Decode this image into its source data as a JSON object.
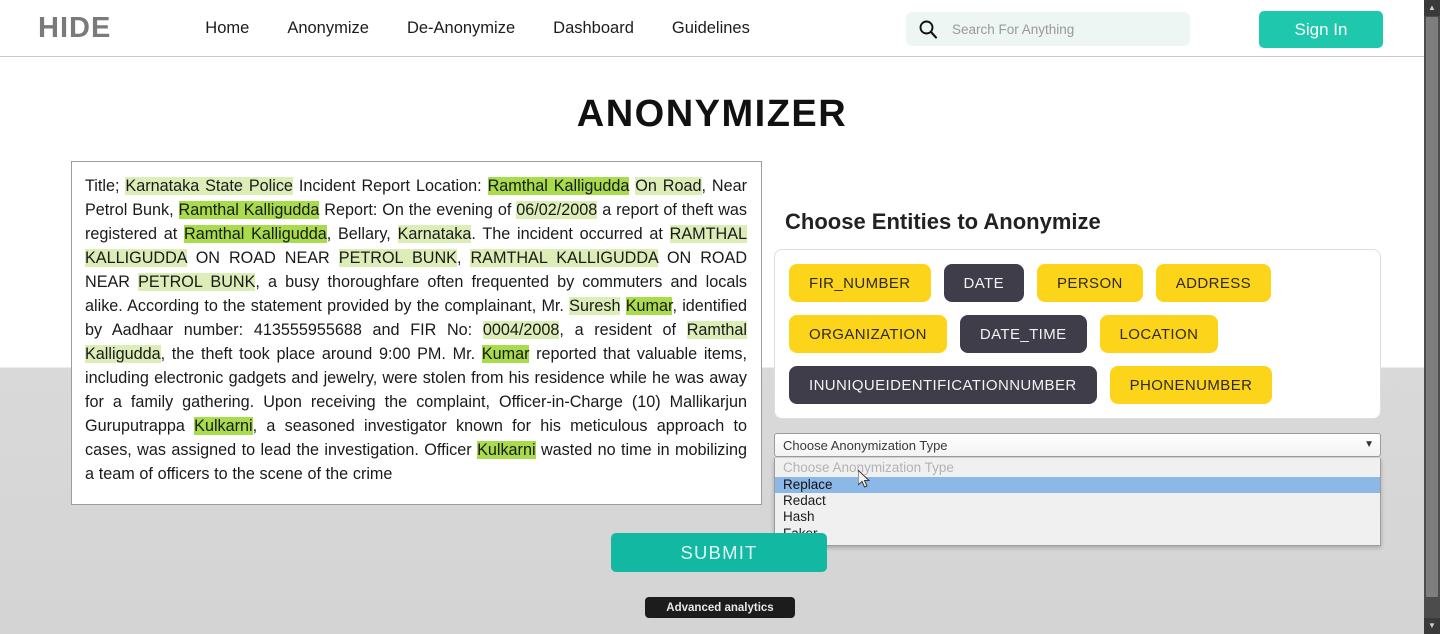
{
  "header": {
    "logo": "HIDE",
    "nav": [
      {
        "label": "Home",
        "name": "nav-home"
      },
      {
        "label": "Anonymize",
        "name": "nav-anonymize"
      },
      {
        "label": "De-Anonymize",
        "name": "nav-de-anonymize"
      },
      {
        "label": "Dashboard",
        "name": "nav-dashboard"
      },
      {
        "label": "Guidelines",
        "name": "nav-guidelines"
      }
    ],
    "search": {
      "value": "",
      "placeholder": "Search For Anything",
      "icon": "search-icon"
    },
    "sign_in_label": "Sign In",
    "accent_color": "#1fc8ac"
  },
  "page": {
    "title": "ANONYMIZER"
  },
  "report": {
    "full_text": "Title; Karnataka State Police Incident Report Location: Ramthal Kalligudda On Road, Near Petrol Bunk, Ramthal Kalligudda Report: On the evening of 06/02/2008 a report of theft was registered at Ramthal Kalligudda, Bellary, Karnataka. The incident occurred at RAMTHAL KALLIGUDDA ON ROAD NEAR PETROL BUNK, RAMTHAL KALLIGUDDA ON ROAD NEAR PETROL BUNK, a busy thoroughfare often frequented by commuters and locals alike. According to the statement provided by the complainant, Mr. Suresh Kumar, identified by Aadhaar number: 413555955688 and FIR No: 0004/2008, a resident of Ramthal Kalligudda, the theft took place around 9:00 PM. Mr. Kumar reported that valuable items, including electronic gadgets and jewelry, were stolen from his residence while he was away for a family gathering. Upon receiving the complaint, Officer-in-Charge (10) Mallikarjun Guruputrappa Kulkarni, a seasoned investigator known for his meticulous approach to cases, was assigned to lead the investigation. Officer Kulkarni wasted no time in mobilizing a team of officers to the scene of the crime",
    "segments": [
      {
        "t": "Title; ",
        "h": "none"
      },
      {
        "t": "Karnataka State Police",
        "h": "light"
      },
      {
        "t": " Incident Report Location: ",
        "h": "none"
      },
      {
        "t": "Ramthal Kalligudda",
        "h": "bright"
      },
      {
        "t": " ",
        "h": "none"
      },
      {
        "t": "On Road",
        "h": "light"
      },
      {
        "t": ", Near Petrol Bunk, ",
        "h": "none"
      },
      {
        "t": "Ramthal Kalligudda",
        "h": "bright"
      },
      {
        "t": " Report: On the evening of ",
        "h": "none"
      },
      {
        "t": "06/02/2008",
        "h": "light"
      },
      {
        "t": " a report of theft was registered at ",
        "h": "none"
      },
      {
        "t": "Ramthal Kalligudda",
        "h": "bright"
      },
      {
        "t": ", Bellary, ",
        "h": "none"
      },
      {
        "t": "Karnataka",
        "h": "light"
      },
      {
        "t": ". The incident occurred at ",
        "h": "none"
      },
      {
        "t": "RAMTHAL KALLIGUDDA",
        "h": "light"
      },
      {
        "t": " ON ROAD NEAR ",
        "h": "none"
      },
      {
        "t": "PETROL BUNK",
        "h": "light"
      },
      {
        "t": ", ",
        "h": "none"
      },
      {
        "t": "RAMTHAL KALLIGUDDA",
        "h": "light"
      },
      {
        "t": " ON ROAD NEAR ",
        "h": "none"
      },
      {
        "t": "PETROL BUNK",
        "h": "light"
      },
      {
        "t": ", a busy thoroughfare often frequented by commuters and locals alike. According to the statement provided by the complainant, Mr. ",
        "h": "none"
      },
      {
        "t": "Suresh",
        "h": "light"
      },
      {
        "t": " ",
        "h": "none"
      },
      {
        "t": "Kumar",
        "h": "bright"
      },
      {
        "t": ", identified by Aadhaar number: 413555955688 and FIR No: ",
        "h": "none"
      },
      {
        "t": "0004/2008",
        "h": "light"
      },
      {
        "t": ", a resident of ",
        "h": "none"
      },
      {
        "t": "Ramthal Kalligudda",
        "h": "light"
      },
      {
        "t": ", the theft took place around 9:00 PM. Mr. ",
        "h": "none"
      },
      {
        "t": "Kumar",
        "h": "bright"
      },
      {
        "t": " reported that valuable items, including electronic gadgets and jewelry, were stolen from his residence while he was away for a family gathering. Upon receiving the complaint, Officer-in-Charge (10) Mallikarjun Guruputrappa ",
        "h": "none"
      },
      {
        "t": "Kulkarni",
        "h": "bright"
      },
      {
        "t": ", a seasoned investigator known for his meticulous approach to cases, was assigned to lead the investigation. Officer ",
        "h": "none"
      },
      {
        "t": "Kulkarni",
        "h": "bright"
      },
      {
        "t": " wasted no time in mobilizing a team of officers to the scene of the crime",
        "h": "none"
      }
    ],
    "highlight_colors": {
      "light": "#dcedb8",
      "bright": "#a9dc4c"
    }
  },
  "entities": {
    "title": "Choose Entities to Anonymize",
    "selected_color": "#fcd419",
    "unselected_color": "#3f3d4a",
    "rows": [
      [
        {
          "label": "FIR_NUMBER",
          "state": "on"
        },
        {
          "label": "DATE",
          "state": "off"
        },
        {
          "label": "PERSON",
          "state": "on"
        },
        {
          "label": "ADDRESS",
          "state": "on"
        }
      ],
      [
        {
          "label": "ORGANIZATION",
          "state": "on"
        },
        {
          "label": "DATE_TIME",
          "state": "off"
        },
        {
          "label": "LOCATION",
          "state": "on"
        }
      ],
      [
        {
          "label": "INUNIQUEIDENTIFICATIONNUMBER",
          "state": "off"
        },
        {
          "label": "PHONENUMBER",
          "state": "on"
        }
      ]
    ]
  },
  "anonymization_select": {
    "selected_value": "Choose Anonymization Type",
    "expanded": true,
    "highlighted_option": "Replace",
    "chevron_icon": "chevron-down-icon",
    "options": [
      {
        "label": "Choose Anonymization Type",
        "placeholder": true,
        "selected": false
      },
      {
        "label": "Replace",
        "placeholder": false,
        "selected": true
      },
      {
        "label": "Redact",
        "placeholder": false,
        "selected": false
      },
      {
        "label": "Hash",
        "placeholder": false,
        "selected": false
      },
      {
        "label": "Faker",
        "placeholder": false,
        "selected": false
      }
    ]
  },
  "actions": {
    "submit_label": "SUBMIT",
    "submit_color": "#12b8a2",
    "advanced_analytics_label": "Advanced analytics"
  },
  "scrollbar": {
    "up_arrow": "▲",
    "down_arrow": "▼"
  }
}
